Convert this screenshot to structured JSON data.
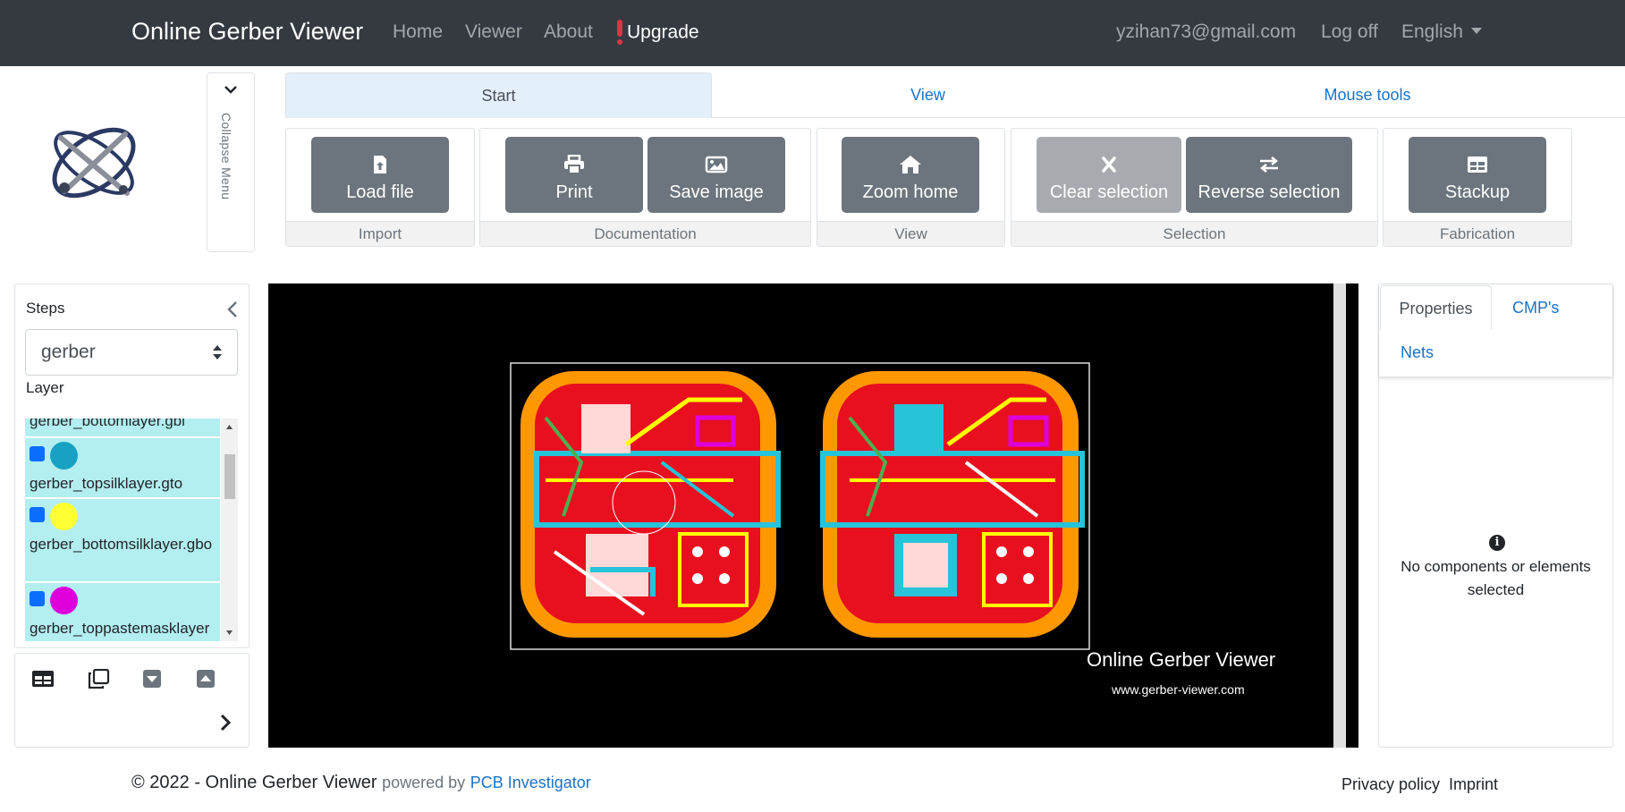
{
  "navbar": {
    "brand": "Online Gerber Viewer",
    "links": [
      "Home",
      "Viewer",
      "About"
    ],
    "upgrade": "Upgrade",
    "user": "yzihan73@gmail.com",
    "logoff": "Log off",
    "language": "English"
  },
  "sidebar_toggle": {
    "label": "Collapse Menu"
  },
  "ribbon": {
    "tabs": [
      "Start",
      "View",
      "Mouse tools"
    ],
    "groups": {
      "import": {
        "label": "Import",
        "load_file": "Load file"
      },
      "documentation": {
        "label": "Documentation",
        "print": "Print",
        "save_image": "Save image"
      },
      "view": {
        "label": "View",
        "zoom_home": "Zoom home"
      },
      "selection": {
        "label": "Selection",
        "clear_selection": "Clear selection",
        "reverse_selection": "Reverse selection"
      },
      "fabrication": {
        "label": "Fabrication",
        "stackup": "Stackup"
      }
    }
  },
  "left_panel": {
    "steps_label": "Steps",
    "steps_value": "gerber",
    "layer_label": "Layer",
    "layers": [
      {
        "name": "gerber_bottomlayer.gbl",
        "color": "#b3eef0"
      },
      {
        "name": "gerber_topsilklayer.gto",
        "color": "#17a2c4"
      },
      {
        "name": "gerber_bottomsilklayer.gbo",
        "color": "#ffff33"
      },
      {
        "name": "gerber_toppastemasklayer",
        "color": "#dd00dd"
      }
    ]
  },
  "canvas": {
    "watermark_title": "Online Gerber Viewer",
    "watermark_url": "www.gerber-viewer.com"
  },
  "right_panel": {
    "tabs": [
      "Properties",
      "CMP's",
      "Nets"
    ],
    "empty_message": "No components or elements selected"
  },
  "footer": {
    "copyright": "© 2022 - Online Gerber Viewer",
    "powered_by": "powered by",
    "powered_link": "PCB Investigator",
    "privacy": "Privacy policy",
    "imprint": "Imprint"
  }
}
